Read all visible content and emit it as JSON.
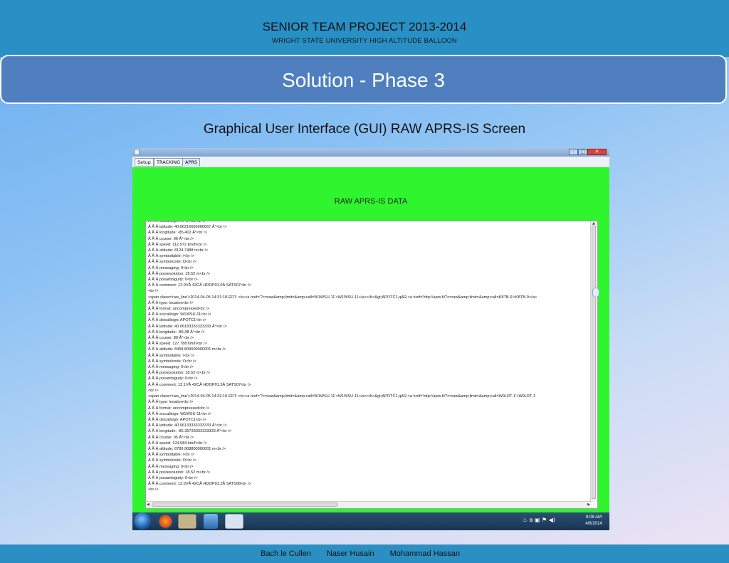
{
  "header": {
    "project_title": "SENIOR TEAM PROJECT 2013-2014",
    "project_subtitle": "WRIGHT STATE UNIVERSITY  HIGH ALTITUDE  BALLOON"
  },
  "slide": {
    "title": "Solution - Phase 3",
    "subtitle": "Graphical User Interface (GUI) RAW APRS-IS  Screen"
  },
  "window": {
    "tabs": [
      {
        "label": "Setup",
        "active": false
      },
      {
        "label": "TRACKING",
        "active": false
      },
      {
        "label": "APRS",
        "active": true
      }
    ],
    "panel_title": "RAW APRS-IS DATA",
    "panel_color": "#2ef52e",
    "log_lines": [
      "Â Â Â dstcallsign: APOTC1<br />",
      "Â Â Â latitude: 40.06216666666667 Â°<br />",
      "Â Â Â longitude: -85.402 Â°<br />",
      "Â Â Â course: 96 Â°<br />",
      "Â Â Â speed: 112.972  km/h<br />",
      "Â Â Â altitude: 8124.7488  m<br />",
      "Â Â Â symboltable: /<br />",
      "Â Â Â symbolcode: O<br />",
      "Â Â Â messaging: 0<br />",
      "Â Â Â posresolution: 18.52  m<br />",
      "Â Â Â posambiguity: 0<br />",
      "Â Â Â comment: 12.0VÂ 42CÂ HDOP01.0Â SATS07<br />",
      "<br />",
      "<span class='raw_line'>2014-04-05 14:31:18 EDT: <b><a href='?c=raw&amp;limit=&amp;call=W1WSU-11'>W1WSU-11</a></b>&gt;APOTC1,qAR,<a href='http://aprs.fi/?c=raw&amp;limit=&amp;call=K8TB-9'>K8TB-9</a>",
      "Â Â Â type: location<br />",
      "Â Â Â format: uncompressed<br />",
      "Â Â Â srccallsign: W1WSU-11<br />",
      "Â Â Â dstcallsign: APOTC1<br />",
      "Â Â Â latitude: 40.06183333333333 Â°<br />",
      "Â Â Â longitude: -85.38 Â°<br />",
      "Â Â Â course: 89 Â°<br />",
      "Â Â Â speed: 127.788  km/h<br />",
      "Â Â Â altitude: 8458.809600000001  m<br />",
      "Â Â Â symboltable: /<br />",
      "Â Â Â symbolcode: O<br />",
      "Â Â Â messaging: 0<br />",
      "Â Â Â posresolution: 18.52  m<br />",
      "Â Â Â posambiguity: 0<br />",
      "Â Â Â comment: 12.1VÂ 42CÂ HDOP01.3Â SATS07<br />",
      "<br />",
      "<span class='raw_line'>2014-04-05 14:32:19 EDT: <b><a href='?c=raw&amp;limit=&amp;call=W1WSU-11'>W1WSU-11</a></b>&gt;APOTC1,qAR,<a href='http://aprs.fi/?c=raw&amp;limit=&amp;call=W9LRT-1'>W9LRT-1",
      "Â Â Â type: location<br />",
      "Â Â Â format: uncompressed<br />",
      "Â Â Â srccallsign: W1WSU-11<br />",
      "Â Â Â dstcallsign: APOTC1<br />",
      "Â Â Â latitude: 40.06133333333333 Â°<br />",
      "Â Â Â longitude: -85.35733333333333 Â°<br />",
      "Â Â Â course: 95 Â°<br />",
      "Â Â Â speed: 124.084  km/h<br />",
      "Â Â Â altitude: 8789.908800000001  m<br />",
      "Â Â Â symboltable: /<br />",
      "Â Â Â symbolcode: O<br />",
      "Â Â Â messaging: 0<br />",
      "Â Â Â posresolution: 18.52  m<br />",
      "Â Â Â posambiguity: 0<br />",
      "Â Â Â comment: 12.0VÂ 42CÂ HDOP01.2Â SATS08<br />",
      "<br />"
    ]
  },
  "taskbar": {
    "clock_time": "8:08 AM",
    "clock_date": "4/6/2014",
    "tray_icons": [
      "speaker-icon",
      "bluetooth-icon",
      "network-icon",
      "flag-icon",
      "volume-icon"
    ]
  },
  "footer": {
    "names": [
      "Bach le Cullen",
      "Naser Husain",
      "Mohammad Hassan"
    ]
  }
}
